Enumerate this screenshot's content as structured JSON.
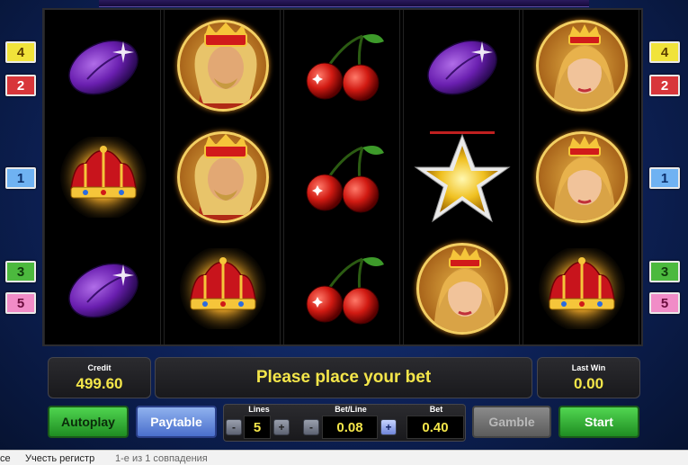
{
  "markers": {
    "left": [
      {
        "num": "4",
        "color": "yellow"
      },
      {
        "num": "2",
        "color": "red"
      },
      {
        "num": "1",
        "color": "blue"
      },
      {
        "num": "3",
        "color": "green"
      },
      {
        "num": "5",
        "color": "pink"
      }
    ],
    "right": [
      {
        "num": "4",
        "color": "yellow"
      },
      {
        "num": "2",
        "color": "red"
      },
      {
        "num": "1",
        "color": "blue"
      },
      {
        "num": "3",
        "color": "green"
      },
      {
        "num": "5",
        "color": "pink"
      }
    ]
  },
  "reels": [
    [
      "plum",
      "crown",
      "plum"
    ],
    [
      "king",
      "king",
      "crown"
    ],
    [
      "cherry",
      "cherry",
      "cherry"
    ],
    [
      "plum",
      "star",
      "queen"
    ],
    [
      "queen",
      "queen",
      "crown"
    ]
  ],
  "credit": {
    "label": "Credit",
    "value": "499.60"
  },
  "message": "Please place your bet",
  "last_win": {
    "label": "Last Win",
    "value": "0.00"
  },
  "buttons": {
    "autoplay": "Autoplay",
    "paytable": "Paytable",
    "gamble": "Gamble",
    "start": "Start"
  },
  "lines": {
    "label": "Lines",
    "value": "5",
    "minus": "-",
    "plus": "+"
  },
  "bet_line": {
    "label": "Bet/Line",
    "value": "0.08",
    "minus": "-",
    "plus": "+"
  },
  "bet": {
    "label": "Bet",
    "value": "0.40"
  },
  "browser_bar": {
    "left_text": "се",
    "case_text": "Учесть регистр",
    "matches": "1-е из 1 совпадения"
  },
  "colors": {
    "accent_yellow": "#f4e64a",
    "background": "#0d2157"
  }
}
